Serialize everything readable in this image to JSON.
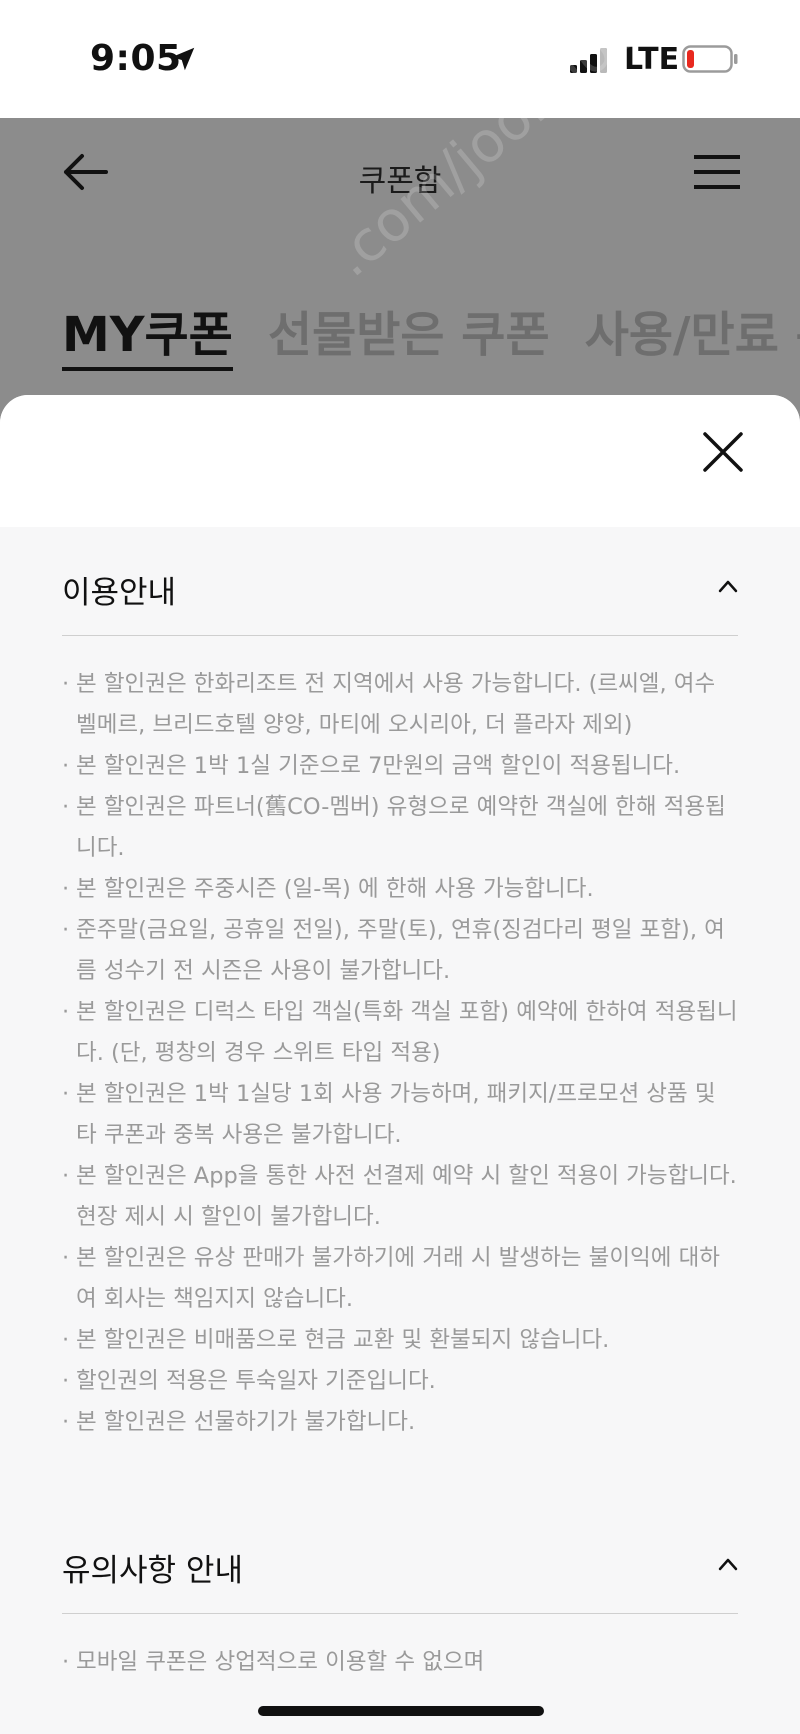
{
  "status_bar": {
    "time": "9:05",
    "network": "LTE"
  },
  "header": {
    "title": "쿠폰함"
  },
  "tabs": [
    {
      "label": "MY쿠폰"
    },
    {
      "label": "선물받은 쿠폰"
    },
    {
      "label": "사용/만료 쿠"
    }
  ],
  "watermark": ".com/joonggonar",
  "sheet": {
    "usage_title": "이용안내",
    "usage_items": [
      "본 할인권은 한화리조트 전 지역에서 사용 가능합니다. (르씨엘, 여수 벨메르, 브리드호텔 양양, 마티에 오시리아, 더 플라자 제외)",
      "본 할인권은 1박 1실 기준으로 7만원의 금액 할인이 적용됩니다.",
      "본 할인권은 파트너(舊CO-멤버) 유형으로 예약한 객실에 한해 적용됩니다.",
      "본 할인권은 주중시즌 (일-목) 에 한해 사용 가능합니다.",
      "준주말(금요일, 공휴일 전일), 주말(토), 연휴(징검다리 평일 포함), 여름 성수기 전 시즌은 사용이 불가합니다.",
      "본 할인권은 디럭스 타입 객실(특화 객실 포함) 예약에 한하여 적용됩니다. (단, 평창의 경우 스위트 타입 적용)",
      "본 할인권은 1박 1실당 1회 사용 가능하며, 패키지/프로모션 상품 및 타 쿠폰과 중복 사용은 불가합니다.",
      "본 할인권은 App을 통한 사전 선결제 예약 시 할인 적용이 가능합니다. 현장 제시 시 할인이 불가합니다.",
      "본 할인권은 유상 판매가 불가하기에 거래 시 발생하는 불이익에 대하여 회사는 책임지지 않습니다.",
      "본 할인권은 비매품으로 현금 교환 및 환불되지 않습니다.",
      "할인권의 적용은 투숙일자 기준입니다.",
      "본 할인권은 선물하기가 불가합니다."
    ],
    "notice_title": "유의사항 안내",
    "notice_items": [
      " 모바일 쿠폰은 상업적으로 이용할 수 없으며"
    ]
  }
}
